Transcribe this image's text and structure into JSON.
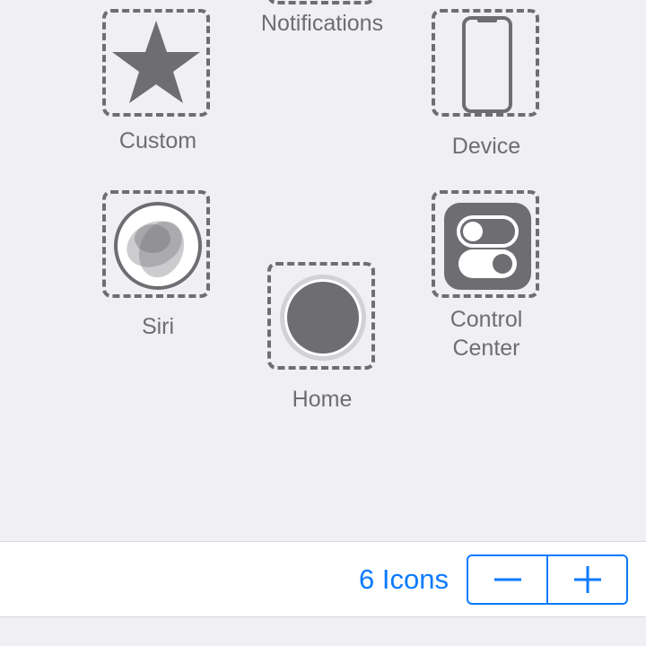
{
  "slots": {
    "notifications": {
      "label": "Notifications",
      "icon": "notifications-icon"
    },
    "custom": {
      "label": "Custom",
      "icon": "star-icon"
    },
    "device": {
      "label": "Device",
      "icon": "iphone-icon"
    },
    "siri": {
      "label": "Siri",
      "icon": "siri-icon"
    },
    "home": {
      "label": "Home",
      "icon": "home-button-icon"
    },
    "control_center": {
      "label": "Control\nCenter",
      "icon": "toggles-icon"
    }
  },
  "toolbar": {
    "icon_count": "6 Icons",
    "decrement_icon": "minus-icon",
    "increment_icon": "plus-icon"
  },
  "colors": {
    "background": "#efeff4",
    "icon_gray": "#6d6d72",
    "accent_blue": "#0a7aff"
  }
}
